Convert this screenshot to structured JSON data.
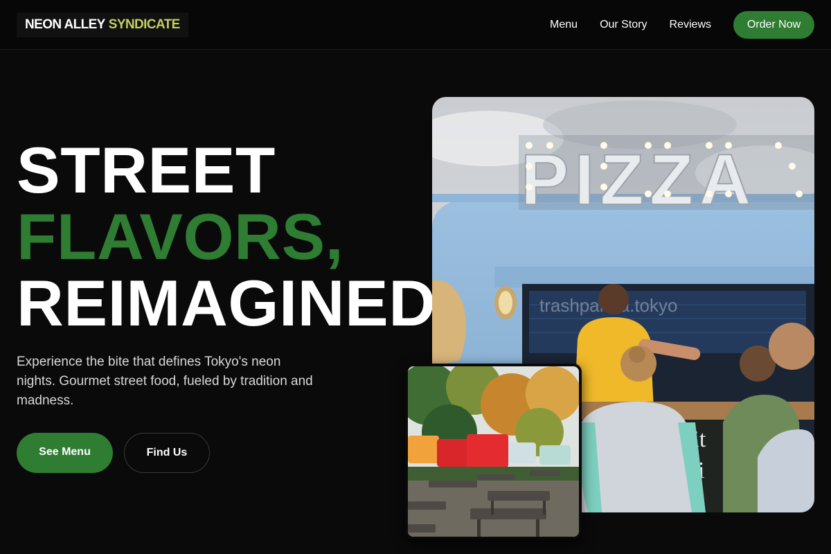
{
  "brand": {
    "name_part1": "NEON ALLEY",
    "name_part2": "SYNDICATE",
    "accent_color": "#c5cf5f"
  },
  "nav": {
    "links": [
      "Menu",
      "Our Story",
      "Reviews"
    ],
    "cta": "Order Now"
  },
  "hero": {
    "headline_line1": "STREET",
    "headline_line2": "FLAVORS,",
    "headline_line3": "REIMAGINED.",
    "subtitle": "Experience the bite that defines Tokyo's neon nights. Gourmet street food, fueled by tradition and madness.",
    "primary_button": "See Menu",
    "secondary_button": "Find Us"
  },
  "images": {
    "main_photo_sign": "PIZZA",
    "main_photo_watermark": "trashpanda.tokyo",
    "main_photo_chalkboard": "erit oni e -"
  },
  "colors": {
    "primary_green": "#2e7d32",
    "background": "#0a0a0a"
  }
}
